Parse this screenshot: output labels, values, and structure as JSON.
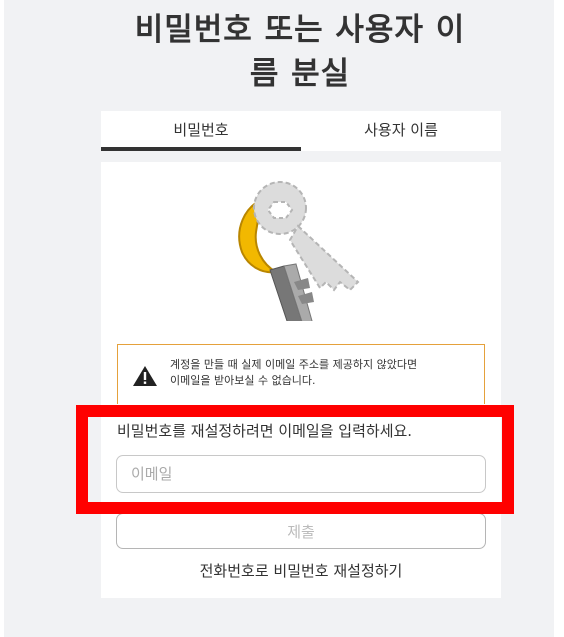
{
  "page": {
    "title_line1": "비밀번호 또는 사용자 이",
    "title_line2": "름 분실"
  },
  "tabs": [
    {
      "label": "비밀번호",
      "active": true
    },
    {
      "label": "사용자 이름",
      "active": false
    }
  ],
  "notice": {
    "icon": "warning-icon",
    "line1": "계정을 만들 때 실제 이메일 주소를 제공하지 않았다면",
    "line2": "이메일을 받아보실 수 없습니다."
  },
  "form": {
    "prompt": "비밀번호를 재설정하려면 이메일을 입력하세요.",
    "email_placeholder": "이메일",
    "email_value": "",
    "submit_label": "제출",
    "phone_reset_link": "전화번호로 비밀번호 재설정하기"
  },
  "colors": {
    "accent_tab": "#333333",
    "notice_border": "#e5a13b",
    "highlight": "#ff0000",
    "key_gold": "#f2b800"
  },
  "illustration": "broken-key-icon"
}
